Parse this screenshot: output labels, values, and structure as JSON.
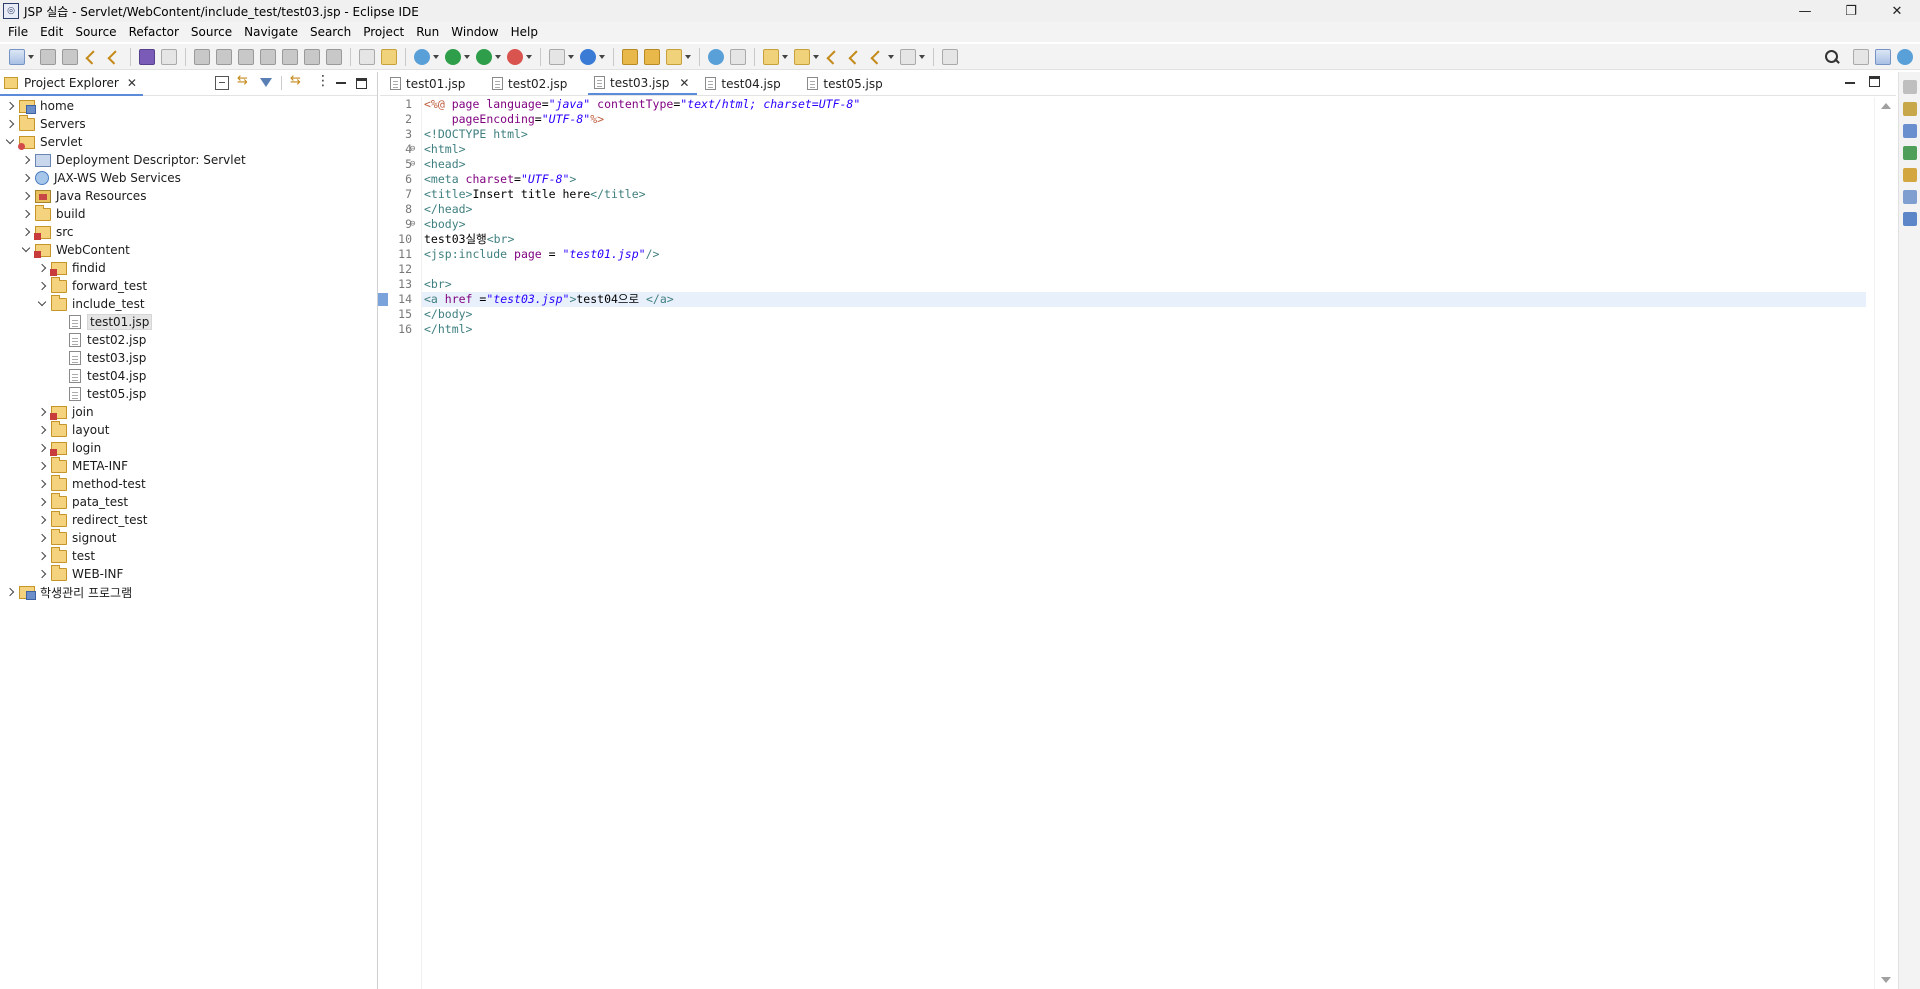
{
  "window": {
    "title": "JSP 실습 - Servlet/WebContent/include_test/test03.jsp - Eclipse IDE",
    "minimize_glyph": "—",
    "maximize_glyph": "❐",
    "close_glyph": "✕"
  },
  "menu": [
    "File",
    "Edit",
    "Source",
    "Refactor",
    "Source",
    "Navigate",
    "Search",
    "Project",
    "Run",
    "Window",
    "Help"
  ],
  "explorer": {
    "title": "Project Explorer",
    "close_glyph": "✕",
    "tree": [
      {
        "label": "home",
        "depth": 0,
        "chev": "right",
        "icon": "project"
      },
      {
        "label": "Servers",
        "depth": 0,
        "chev": "right",
        "icon": "folder"
      },
      {
        "label": "Servlet",
        "depth": 0,
        "chev": "down",
        "icon": "webproj"
      },
      {
        "label": "Deployment Descriptor: Servlet",
        "depth": 1,
        "chev": "right",
        "icon": "dd"
      },
      {
        "label": "JAX-WS Web Services",
        "depth": 1,
        "chev": "right",
        "icon": "ws"
      },
      {
        "label": "Java Resources",
        "depth": 1,
        "chev": "right",
        "icon": "jres"
      },
      {
        "label": "build",
        "depth": 1,
        "chev": "right",
        "icon": "folder"
      },
      {
        "label": "src",
        "depth": 1,
        "chev": "right",
        "icon": "src"
      },
      {
        "label": "WebContent",
        "depth": 1,
        "chev": "down",
        "icon": "src"
      },
      {
        "label": "findid",
        "depth": 2,
        "chev": "right",
        "icon": "src"
      },
      {
        "label": "forward_test",
        "depth": 2,
        "chev": "right",
        "icon": "folder"
      },
      {
        "label": "include_test",
        "depth": 2,
        "chev": "down",
        "icon": "folder"
      },
      {
        "label": "test01.jsp",
        "depth": 3,
        "chev": "none",
        "icon": "file",
        "selected": true
      },
      {
        "label": "test02.jsp",
        "depth": 3,
        "chev": "none",
        "icon": "file"
      },
      {
        "label": "test03.jsp",
        "depth": 3,
        "chev": "none",
        "icon": "file"
      },
      {
        "label": "test04.jsp",
        "depth": 3,
        "chev": "none",
        "icon": "file"
      },
      {
        "label": "test05.jsp",
        "depth": 3,
        "chev": "none",
        "icon": "file"
      },
      {
        "label": "join",
        "depth": 2,
        "chev": "right",
        "icon": "src"
      },
      {
        "label": "layout",
        "depth": 2,
        "chev": "right",
        "icon": "folder"
      },
      {
        "label": "login",
        "depth": 2,
        "chev": "right",
        "icon": "src"
      },
      {
        "label": "META-INF",
        "depth": 2,
        "chev": "right",
        "icon": "folder"
      },
      {
        "label": "method-test",
        "depth": 2,
        "chev": "right",
        "icon": "folder"
      },
      {
        "label": "pata_test",
        "depth": 2,
        "chev": "right",
        "icon": "folder"
      },
      {
        "label": "redirect_test",
        "depth": 2,
        "chev": "right",
        "icon": "folder"
      },
      {
        "label": " signout",
        "depth": 2,
        "chev": "right",
        "icon": "folder"
      },
      {
        "label": "test",
        "depth": 2,
        "chev": "right",
        "icon": "folder"
      },
      {
        "label": "WEB-INF",
        "depth": 2,
        "chev": "right",
        "icon": "folder"
      },
      {
        "label": "학생관리 프로그램",
        "depth": 0,
        "chev": "right",
        "icon": "project"
      }
    ]
  },
  "editor": {
    "tabs": [
      {
        "label": "test01.jsp",
        "active": false
      },
      {
        "label": "test02.jsp",
        "active": false
      },
      {
        "label": "test03.jsp",
        "active": true
      },
      {
        "label": "test04.jsp",
        "active": false
      },
      {
        "label": "test05.jsp",
        "active": false
      }
    ],
    "tab_close_glyph": "✕",
    "current_line": 14,
    "lines": [
      {
        "n": "1",
        "fold": false,
        "parts": [
          [
            "dir",
            "<%@ "
          ],
          [
            "attr",
            "page "
          ],
          [
            "attr",
            "language"
          ],
          [
            "txt",
            "="
          ],
          [
            "str",
            "\"java\""
          ],
          [
            "txt",
            " "
          ],
          [
            "attr",
            "contentType"
          ],
          [
            "txt",
            "="
          ],
          [
            "str",
            "\"text/html; charset=UTF-8\""
          ]
        ]
      },
      {
        "n": "2",
        "fold": false,
        "parts": [
          [
            "txt",
            "    "
          ],
          [
            "attr",
            "pageEncoding"
          ],
          [
            "txt",
            "="
          ],
          [
            "str",
            "\"UTF-8\""
          ],
          [
            "dir",
            "%>"
          ]
        ]
      },
      {
        "n": "3",
        "fold": false,
        "parts": [
          [
            "tag",
            "<!DOCTYPE html>"
          ]
        ]
      },
      {
        "n": "4",
        "fold": true,
        "parts": [
          [
            "tag",
            "<html>"
          ]
        ]
      },
      {
        "n": "5",
        "fold": true,
        "parts": [
          [
            "tag",
            "<head>"
          ]
        ]
      },
      {
        "n": "6",
        "fold": false,
        "parts": [
          [
            "tag",
            "<meta "
          ],
          [
            "attr",
            "charset"
          ],
          [
            "txt",
            "="
          ],
          [
            "str",
            "\"UTF-8\""
          ],
          [
            "tag",
            ">"
          ]
        ]
      },
      {
        "n": "7",
        "fold": false,
        "parts": [
          [
            "tag",
            "<title>"
          ],
          [
            "txt",
            "Insert title here"
          ],
          [
            "tag",
            "</title>"
          ]
        ]
      },
      {
        "n": "8",
        "fold": false,
        "parts": [
          [
            "tag",
            "</head>"
          ]
        ]
      },
      {
        "n": "9",
        "fold": true,
        "parts": [
          [
            "tag",
            "<body>"
          ]
        ]
      },
      {
        "n": "10",
        "fold": false,
        "parts": [
          [
            "txt",
            "test03실행"
          ],
          [
            "tag",
            "<br>"
          ]
        ]
      },
      {
        "n": "11",
        "fold": false,
        "parts": [
          [
            "tag",
            "<jsp:include "
          ],
          [
            "attr",
            "page "
          ],
          [
            "txt",
            "= "
          ],
          [
            "str",
            "\"test01.jsp\""
          ],
          [
            "tag",
            "/>"
          ]
        ]
      },
      {
        "n": "12",
        "fold": false,
        "parts": []
      },
      {
        "n": "13",
        "fold": false,
        "parts": [
          [
            "tag",
            "<br>"
          ]
        ]
      },
      {
        "n": "14",
        "fold": false,
        "parts": [
          [
            "tag",
            "<a "
          ],
          [
            "attr",
            "href "
          ],
          [
            "txt",
            "="
          ],
          [
            "str",
            "\"test03.jsp\""
          ],
          [
            "tag",
            ">"
          ],
          [
            "txt",
            "test04으로 "
          ],
          [
            "tag",
            "</a>"
          ]
        ]
      },
      {
        "n": "15",
        "fold": false,
        "parts": [
          [
            "tag",
            "</body>"
          ]
        ]
      },
      {
        "n": "16",
        "fold": false,
        "parts": [
          [
            "tag",
            "</html>"
          ]
        ]
      }
    ]
  }
}
